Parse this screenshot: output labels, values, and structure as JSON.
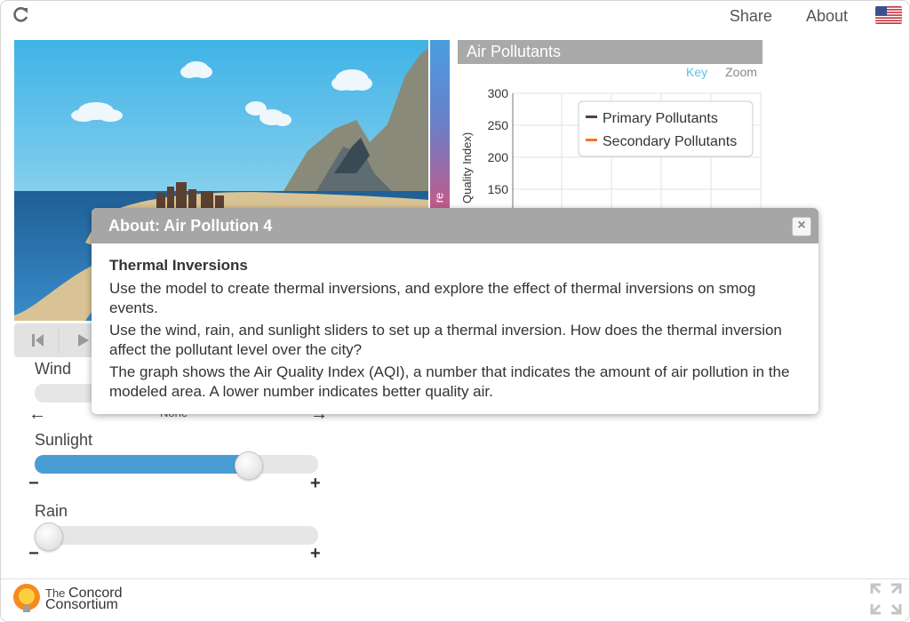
{
  "topbar": {
    "share": "Share",
    "about": "About",
    "language_icon": "us-flag-icon"
  },
  "chart": {
    "title": "Air Pollutants",
    "key_link": "Key",
    "zoom_link": "Zoom",
    "ylabel_visible": "Quality Index)",
    "yticks": [
      "300",
      "250",
      "200",
      "150"
    ],
    "legend": [
      {
        "label": "Primary Pollutants",
        "color": "#5c4033"
      },
      {
        "label": "Secondary Pollutants",
        "color": "#f07820"
      }
    ]
  },
  "model": {
    "temperature_label_fragment": "re"
  },
  "controls": {
    "wind": {
      "label": "Wind",
      "value_text": "None"
    },
    "sunlight": {
      "label": "Sunlight",
      "minus": "−",
      "plus": "+",
      "level": 0.78
    },
    "rain": {
      "label": "Rain",
      "minus": "−",
      "plus": "+",
      "level": 0.0
    }
  },
  "modal": {
    "title": "About: Air Pollution 4",
    "close": "×",
    "heading": "Thermal Inversions",
    "paragraphs": [
      "Use the model to create thermal inversions, and explore the effect of thermal inversions on smog events.",
      "Use the wind, rain, and sunlight sliders to set up a thermal inversion. How does the thermal inversion affect the pollutant level over the city?",
      "The graph shows the Air Quality Index (AQI), a number that indicates the amount of air pollution in the modeled area. A lower number indicates better quality air."
    ]
  },
  "footer": {
    "logo_small": "The",
    "logo_line1": "Concord",
    "logo_line2": "Consortium"
  }
}
